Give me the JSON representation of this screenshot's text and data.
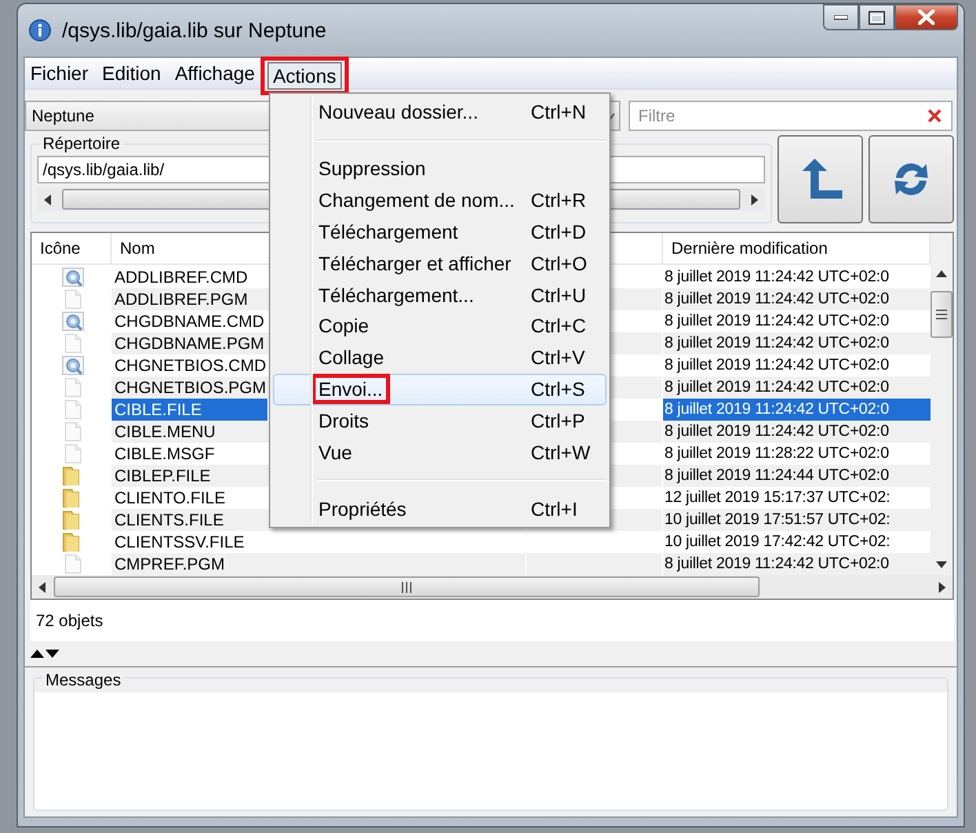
{
  "window": {
    "title": "/qsys.lib/gaia.lib sur Neptune"
  },
  "menubar": [
    {
      "label": "Fichier",
      "selected": false,
      "annotated": false
    },
    {
      "label": "Edition",
      "selected": false,
      "annotated": false
    },
    {
      "label": "Affichage",
      "selected": false,
      "annotated": false
    },
    {
      "label": "Actions",
      "selected": true,
      "annotated": true
    }
  ],
  "actions_menu": [
    {
      "kind": "item",
      "label": "Nouveau dossier...",
      "shortcut": "Ctrl+N",
      "selected": false,
      "annotated": false
    },
    {
      "kind": "separator"
    },
    {
      "kind": "item",
      "label": "Suppression",
      "selected": false,
      "annotated": false
    },
    {
      "kind": "item",
      "label": "Changement de nom...",
      "shortcut": "Ctrl+R",
      "selected": false,
      "annotated": false
    },
    {
      "kind": "item",
      "label": "Téléchargement",
      "shortcut": "Ctrl+D",
      "selected": false,
      "annotated": false
    },
    {
      "kind": "item",
      "label": "Télécharger et afficher",
      "shortcut": "Ctrl+O",
      "selected": false,
      "annotated": false
    },
    {
      "kind": "item",
      "label": "Téléchargement...",
      "shortcut": "Ctrl+U",
      "selected": false,
      "annotated": false
    },
    {
      "kind": "item",
      "label": "Copie",
      "shortcut": "Ctrl+C",
      "selected": false,
      "annotated": false
    },
    {
      "kind": "item",
      "label": "Collage",
      "shortcut": "Ctrl+V",
      "selected": false,
      "annotated": false
    },
    {
      "kind": "item",
      "label": "Envoi...",
      "shortcut": "Ctrl+S",
      "selected": true,
      "annotated": true
    },
    {
      "kind": "item",
      "label": "Droits",
      "shortcut": "Ctrl+P",
      "selected": false,
      "annotated": false
    },
    {
      "kind": "item",
      "label": "Vue",
      "shortcut": "Ctrl+W",
      "selected": false,
      "annotated": false
    },
    {
      "kind": "separator"
    },
    {
      "kind": "item",
      "label": "Propriétés",
      "shortcut": "Ctrl+I",
      "selected": false,
      "annotated": false
    }
  ],
  "system_combo": {
    "value": "Neptune"
  },
  "filter": {
    "placeholder": "Filtre"
  },
  "directory": {
    "label": "Répertoire",
    "path": "/qsys.lib/gaia.lib/"
  },
  "table": {
    "columns": [
      "Icône",
      "Nom",
      "Dernière modification"
    ],
    "rows": [
      {
        "kind": "command",
        "name": "ADDLIBREF.CMD",
        "modified": "8 juillet 2019 11:24:42 UTC+02:0",
        "selected": false
      },
      {
        "kind": "file",
        "name": "ADDLIBREF.PGM",
        "modified": "8 juillet 2019 11:24:42 UTC+02:0",
        "selected": false
      },
      {
        "kind": "command",
        "name": "CHGDBNAME.CMD",
        "modified": "8 juillet 2019 11:24:42 UTC+02:0",
        "selected": false
      },
      {
        "kind": "file",
        "name": "CHGDBNAME.PGM",
        "modified": "8 juillet 2019 11:24:42 UTC+02:0",
        "selected": false
      },
      {
        "kind": "command",
        "name": "CHGNETBIOS.CMD",
        "modified": "8 juillet 2019 11:24:42 UTC+02:0",
        "selected": false
      },
      {
        "kind": "file",
        "name": "CHGNETBIOS.PGM",
        "modified": "8 juillet 2019 11:24:42 UTC+02:0",
        "selected": false
      },
      {
        "kind": "file",
        "name": "CIBLE.FILE",
        "modified": "8 juillet 2019 11:24:42 UTC+02:0",
        "selected": true
      },
      {
        "kind": "file",
        "name": "CIBLE.MENU",
        "modified": "8 juillet 2019 11:24:42 UTC+02:0",
        "selected": false
      },
      {
        "kind": "file",
        "name": "CIBLE.MSGF",
        "modified": "8 juillet 2019 11:28:22 UTC+02:0",
        "selected": false
      },
      {
        "kind": "folder",
        "name": "CIBLEP.FILE",
        "modified": "8 juillet 2019 11:24:44 UTC+02:0",
        "selected": false
      },
      {
        "kind": "folder",
        "name": "CLIENTO.FILE",
        "modified": "12 juillet 2019 15:17:37 UTC+02:",
        "selected": false
      },
      {
        "kind": "folder",
        "name": "CLIENTS.FILE",
        "modified": "10 juillet 2019 17:51:57 UTC+02:",
        "selected": false
      },
      {
        "kind": "folder",
        "name": "CLIENTSSV.FILE",
        "modified": "10 juillet 2019 17:42:42 UTC+02:",
        "selected": false
      },
      {
        "kind": "file",
        "name": "CMPREF.PGM",
        "modified": "8 juillet 2019 11:24:42 UTC+02:0",
        "selected": false
      }
    ]
  },
  "status": "72 objets",
  "messages": {
    "label": "Messages"
  }
}
